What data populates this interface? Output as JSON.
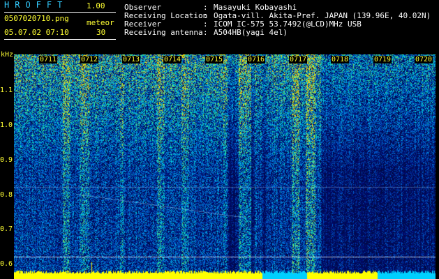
{
  "app": {
    "title": "HROFFT",
    "version": "1.00"
  },
  "file": {
    "name": "0507020710.png",
    "mode": "meteor",
    "datetime": "05.07.02 07:10",
    "count": "30"
  },
  "info": [
    {
      "label": "Observer",
      "value": "Masayuki Kobayashi"
    },
    {
      "label": "Receiving Location",
      "value": "Ogata-vill. Akita-Pref. JAPAN (139.96E, 40.02N)"
    },
    {
      "label": "Receiver",
      "value": "ICOM IC-575 53.7492(@LCD)MHz USB"
    },
    {
      "label": "Receiving antenna",
      "value": "A504HB(yagi 4el)"
    }
  ],
  "axis": {
    "unit": "kHz",
    "freq_ticks": [
      "1.1",
      "1.0",
      "0.9",
      "0.8",
      "0.7",
      "0.6"
    ],
    "time_ticks": [
      "0711",
      "0712",
      "0713",
      "0714",
      "0715",
      "0716",
      "0717",
      "0718",
      "0719",
      "0720"
    ]
  },
  "colors": {
    "label": "#ffff33",
    "background": "#000000",
    "spectrogram_base": "#020a44",
    "signal": "#ffff00"
  }
}
